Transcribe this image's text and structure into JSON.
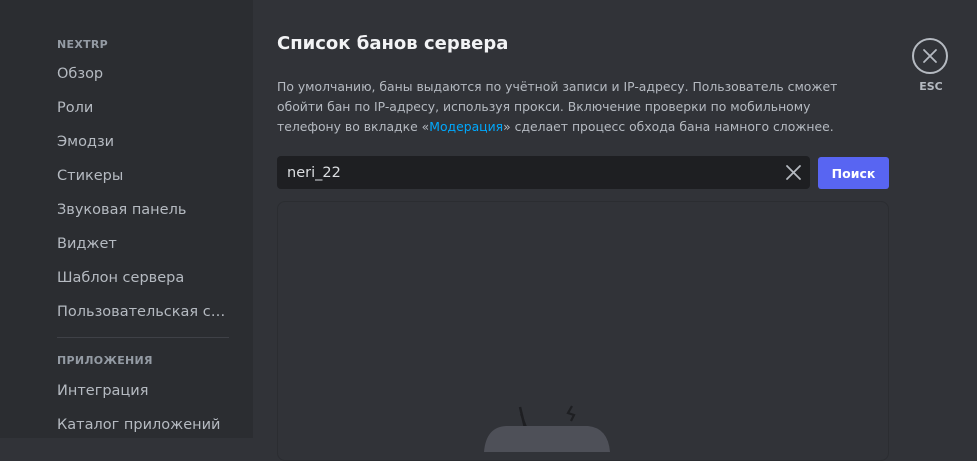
{
  "sidebar": {
    "server_section": "NEXTRP",
    "server_items": [
      {
        "label": "Обзор"
      },
      {
        "label": "Роли"
      },
      {
        "label": "Эмодзи"
      },
      {
        "label": "Стикеры"
      },
      {
        "label": "Звуковая панель"
      },
      {
        "label": "Виджет"
      },
      {
        "label": "Шаблон сервера"
      },
      {
        "label": "Пользовательская ссылка приглашения"
      }
    ],
    "apps_section": "ПРИЛОЖЕНИЯ",
    "apps_items": [
      {
        "label": "Интеграция"
      },
      {
        "label": "Каталог приложений"
      }
    ]
  },
  "main": {
    "title": "Список банов сервера",
    "description_part1": "По умолчанию, баны выдаются по учётной записи и IP-адресу. Пользователь сможет обойти бан по IP-адресу, используя прокси. Включение проверки по мобильному телефону во вкладке «",
    "description_link": "Модерация",
    "description_part2": "» сделает процесс обхода бана намного сложнее.",
    "search": {
      "value": "neri_22",
      "button_label": "Поиск"
    }
  },
  "close": {
    "esc_label": "ESC"
  },
  "colors": {
    "background": "#313338",
    "sidebar": "#2b2d31",
    "input": "#1e1f22",
    "accent": "#5865f2",
    "link": "#00a8fc"
  },
  "icons": {
    "clear": "close-icon",
    "close": "close-icon"
  }
}
